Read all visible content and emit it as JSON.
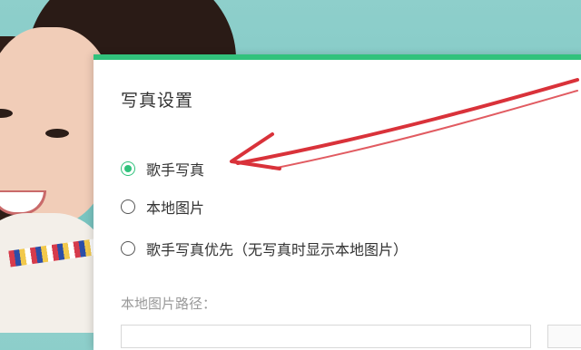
{
  "dialog": {
    "title": "写真设置",
    "options": [
      {
        "label": "歌手写真",
        "checked": true
      },
      {
        "label": "本地图片",
        "checked": false
      },
      {
        "label": "歌手写真优先（无写真时显示本地图片）",
        "checked": false
      }
    ],
    "path_label": "本地图片路径：",
    "path_value": ""
  },
  "colors": {
    "accent": "#31c27c",
    "arrow": "#d9323a",
    "background": "#7cc6c2"
  },
  "icons": [
    "radio-checked-icon",
    "radio-unchecked-icon",
    "annotation-arrow-icon"
  ]
}
